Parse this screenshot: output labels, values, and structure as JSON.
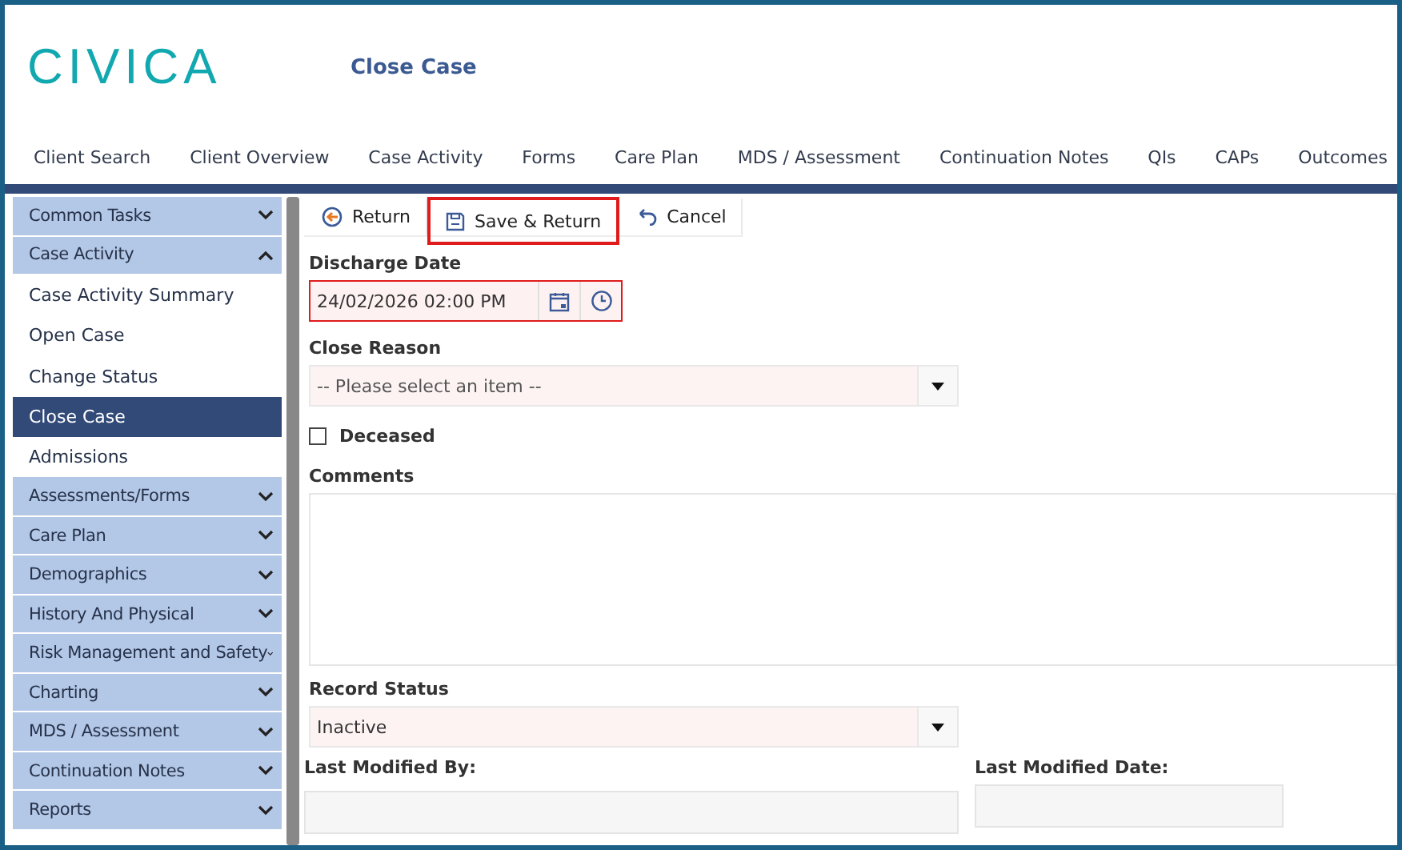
{
  "header": {
    "logo": "CIVICA",
    "title": "Close Case"
  },
  "nav": [
    "Client Search",
    "Client Overview",
    "Case Activity",
    "Forms",
    "Care Plan",
    "MDS / Assessment",
    "Continuation Notes",
    "QIs",
    "CAPs",
    "Outcomes"
  ],
  "sidebar": {
    "items": [
      {
        "label": "Common Tasks",
        "expanded": false
      },
      {
        "label": "Case Activity",
        "expanded": true,
        "children": [
          {
            "label": "Case Activity Summary",
            "selected": false
          },
          {
            "label": "Open Case",
            "selected": false
          },
          {
            "label": "Change Status",
            "selected": false
          },
          {
            "label": "Close Case",
            "selected": true
          },
          {
            "label": "Admissions",
            "selected": false
          }
        ]
      },
      {
        "label": "Assessments/Forms",
        "expanded": false
      },
      {
        "label": "Care Plan",
        "expanded": false
      },
      {
        "label": "Demographics",
        "expanded": false
      },
      {
        "label": "History And Physical",
        "expanded": false
      },
      {
        "label": "Risk Management and Safety",
        "expanded": false
      },
      {
        "label": "Charting",
        "expanded": false
      },
      {
        "label": "MDS / Assessment",
        "expanded": false
      },
      {
        "label": "Continuation Notes",
        "expanded": false
      },
      {
        "label": "Reports",
        "expanded": false
      }
    ]
  },
  "toolbar": [
    {
      "kind": "return",
      "label": "Return",
      "highlighted": false
    },
    {
      "kind": "save",
      "label": "Save & Return",
      "highlighted": true
    },
    {
      "kind": "cancel",
      "label": "Cancel",
      "highlighted": false
    }
  ],
  "form": {
    "discharge_date": {
      "label": "Discharge Date",
      "value": "24/02/2026 02:00 PM",
      "invalid": true
    },
    "close_reason": {
      "label": "Close Reason",
      "placeholder": "-- Please select an item --"
    },
    "deceased": {
      "label": "Deceased",
      "checked": false
    },
    "comments": {
      "label": "Comments"
    },
    "record_status": {
      "label": "Record Status",
      "value": "Inactive"
    },
    "last_modified_by": {
      "label": "Last Modified By:"
    },
    "last_modified_date": {
      "label": "Last Modified Date:"
    }
  }
}
